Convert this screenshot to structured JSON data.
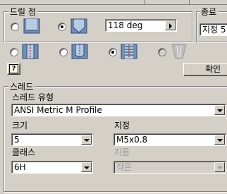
{
  "drill_point": {
    "title": "드릴 점",
    "angle_value": "118 deg"
  },
  "termination": {
    "title": "종료",
    "value": "지정 5"
  },
  "help_button": {
    "label": "?"
  },
  "ok_button": {
    "label": "확인"
  },
  "thread": {
    "title": "스레드",
    "type_label": "스레드 유형",
    "type_value": "ANSI Metric M Profile",
    "size_label": "크기",
    "size_value": "5",
    "designation_label": "지정",
    "designation_value": "M5x0.8",
    "class_label": "클래스",
    "class_value": "6H",
    "diameter_label": "지름",
    "diameter_value": "작은"
  },
  "icons": {
    "drill_flat": "flat-drill-point-icon",
    "drill_angle": "angled-drill-point-icon",
    "hole_tapped": "tapped-hole-icon",
    "hole_clearance": "clearance-hole-icon",
    "hole_thread_selected": "threaded-hole-icon",
    "hole_taper": "taper-tapped-hole-icon"
  }
}
